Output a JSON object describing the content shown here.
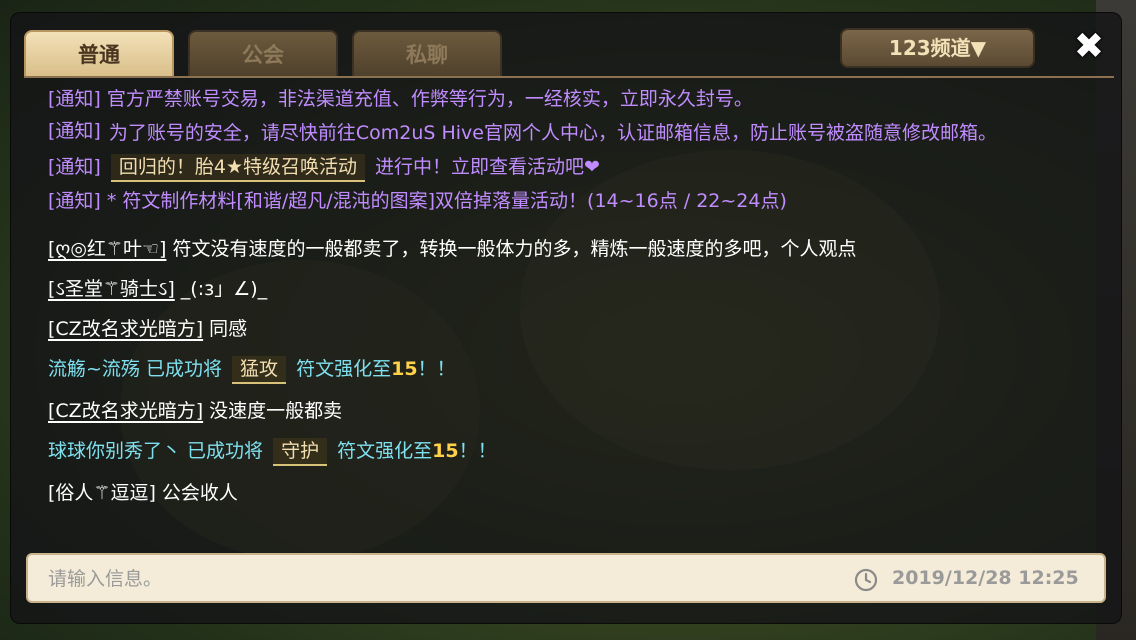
{
  "tabs": [
    {
      "label": "普通",
      "active": true
    },
    {
      "label": "公会",
      "active": false
    },
    {
      "label": "私聊",
      "active": false
    }
  ],
  "channel_label": "123频道▼",
  "close_icon": "✖",
  "notices": [
    {
      "tag": "[通知]",
      "text": "官方严禁账号交易，非法渠道充值、作弊等行为，一经核实，立即永久封号。"
    },
    {
      "tag": "[通知]",
      "text": "为了账号的安全，请尽快前往Com2uS Hive官网个人中心，认证邮箱信息，防止账号被盗随意修改邮箱。"
    },
    {
      "tag": "[通知]",
      "chip": "回归的！胎4★特级召唤活动",
      "after": "进行中！立即查看活动吧❤"
    },
    {
      "tag": "[通知]",
      "text": "* 符文制作材料[和谐/超凡/混沌的图案]双倍掉落量活动！(14~16点 / 22~24点)"
    }
  ],
  "messages": [
    {
      "sender": "[ღ◎红⚚叶☜]",
      "text": "符文没有速度的一般都卖了，转换一般体力的多，精炼一般速度的多吧，个人观点"
    },
    {
      "sender": "[ઽ圣堂⚚骑士ઽ]",
      "text": "_(:з」∠)_"
    },
    {
      "sender": "[CZ改名求光暗方]",
      "text": "同感"
    },
    {
      "system": true,
      "prefix": "流觞~流殇 已成功将",
      "chip": "猛攻",
      "suffix_a": "符文强化至",
      "num": "15",
      "suffix_b": "！！"
    },
    {
      "sender": "[CZ改名求光暗方]",
      "text": "没速度一般都卖"
    },
    {
      "system": true,
      "prefix": "球球你别秀了丶 已成功将",
      "chip": "守护",
      "suffix_a": "符文强化至",
      "num": "15",
      "suffix_b": "！！"
    },
    {
      "sender": "[俗人⚚逗逗]",
      "text": "公会收人"
    }
  ],
  "input": {
    "placeholder": "请输入信息。"
  },
  "timestamp": "2019/12/28  12:25",
  "colors": {
    "notice": "#c08cff",
    "system": "#7ee0ee",
    "chip_border": "#d8c27a",
    "tab_active": "#e8d3a4"
  }
}
